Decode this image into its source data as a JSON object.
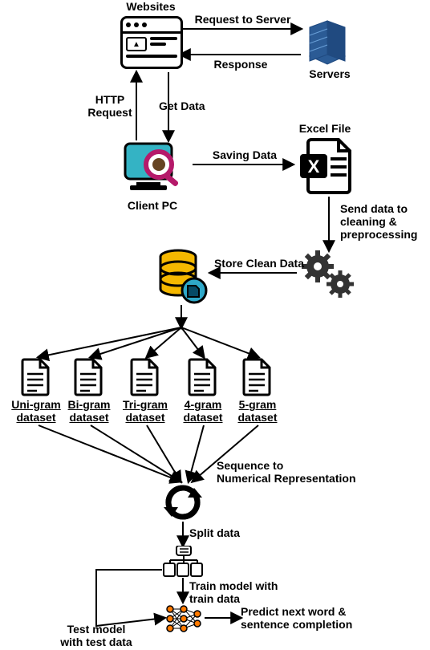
{
  "nodes": {
    "websites": "Websites",
    "servers": "Servers",
    "client_pc": "Client PC",
    "excel_file": "Excel File"
  },
  "edges": {
    "request_to_server": "Request to Server",
    "response": "Response",
    "http_request": "HTTP\nRequest",
    "get_data": "Get Data",
    "saving_data": "Saving Data",
    "send_cleaning": "Send data to\ncleaning &\npreprocessing",
    "store_clean": "Store Clean Data",
    "seq_numrep": "Sequence to\nNumerical Representation",
    "split_data": "Split data",
    "train_with": "Train model with\ntrain data",
    "test_with": "Test model\nwith test data",
    "predict": "Predict next word &\nsentence completion"
  },
  "datasets": [
    "Uni-gram\ndataset",
    "Bi-gram\ndataset",
    "Tri-gram\ndataset",
    "4-gram\ndataset",
    "5-gram\ndataset"
  ]
}
